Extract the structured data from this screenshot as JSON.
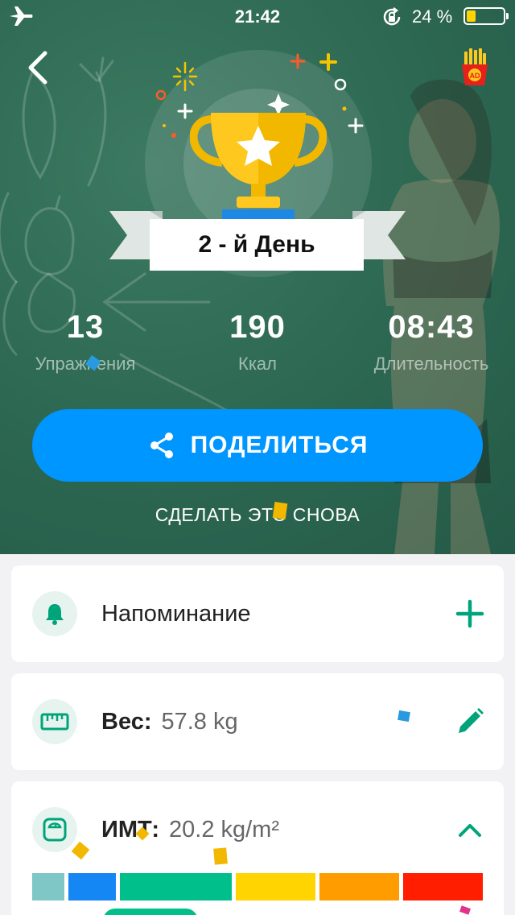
{
  "status_bar": {
    "time": "21:42",
    "battery": "24 %"
  },
  "result": {
    "day_label": "2 - й День",
    "stats": [
      {
        "value": "13",
        "label": "Упражнения"
      },
      {
        "value": "190",
        "label": "Ккал"
      },
      {
        "value": "08:43",
        "label": "Длительность"
      }
    ]
  },
  "actions": {
    "share_label": "ПОДЕЛИТЬСЯ",
    "again_label": "СДЕЛАТЬ ЭТО СНОВА"
  },
  "ad_label": "AD",
  "cards": {
    "reminder": {
      "label": "Напоминание"
    },
    "weight": {
      "label": "Вес:",
      "value": "57.8 kg"
    },
    "bmi": {
      "label": "ИМТ:",
      "value": "20.2 kg/m²"
    }
  },
  "bmi_scale_colors": [
    "#7fc6c6",
    "#1487f5",
    "#00bf8b",
    "#ffd400",
    "#ff9c00",
    "#ff1e00"
  ],
  "colors": {
    "accent": "#0096ff",
    "green": "#00a47a",
    "hero_bg": "#2e6a54"
  }
}
